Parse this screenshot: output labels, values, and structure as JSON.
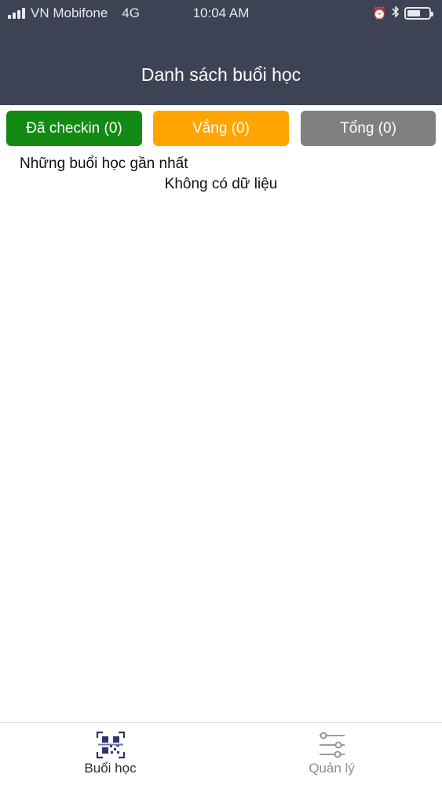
{
  "status_bar": {
    "carrier": "VN Mobifone",
    "network": "4G",
    "time": "10:04 AM"
  },
  "header": {
    "title": "Danh sách buổi học"
  },
  "filters": {
    "checked_in": "Đã checkin (0)",
    "absent": "Vắng (0)",
    "total": "Tổng (0)"
  },
  "content": {
    "section_label": "Những buổi học gần nhất",
    "empty_message": "Không có dữ liệu"
  },
  "tab_bar": {
    "tabs": [
      {
        "label": "Buổi học",
        "icon": "qr-scan-icon",
        "active": true
      },
      {
        "label": "Quản lý",
        "icon": "sliders-icon",
        "active": false
      }
    ]
  },
  "colors": {
    "header_bg": "#3d4254",
    "checked_in": "#138a13",
    "absent": "#ffa500",
    "total": "#808080"
  }
}
